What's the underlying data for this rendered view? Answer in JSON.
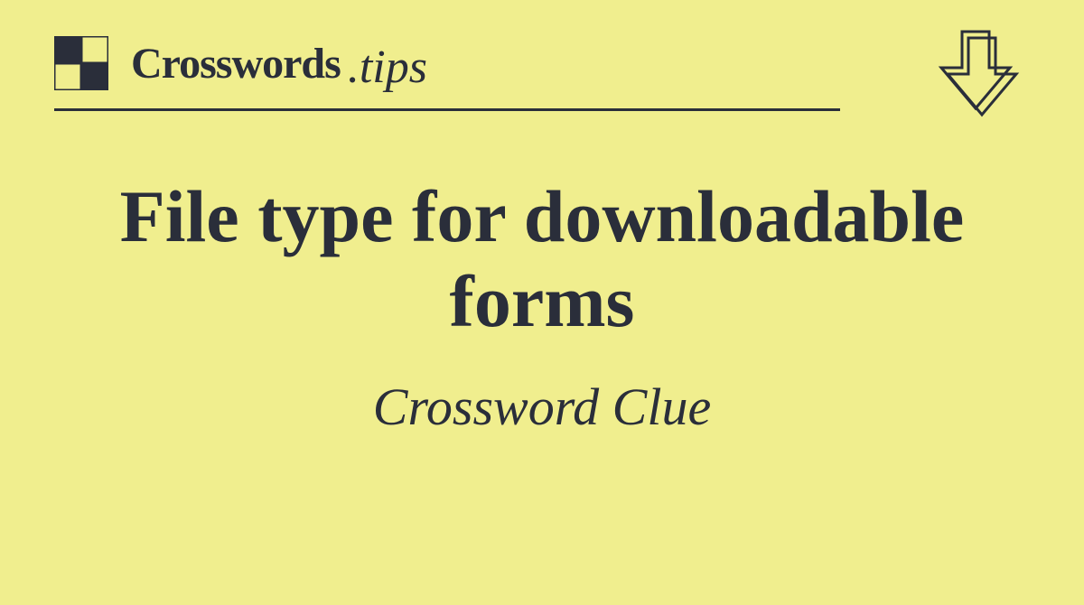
{
  "brand": {
    "name": "Crosswords",
    "suffix": ".tips"
  },
  "clue": {
    "title": "File type for downloadable forms",
    "subtitle": "Crossword Clue"
  }
}
